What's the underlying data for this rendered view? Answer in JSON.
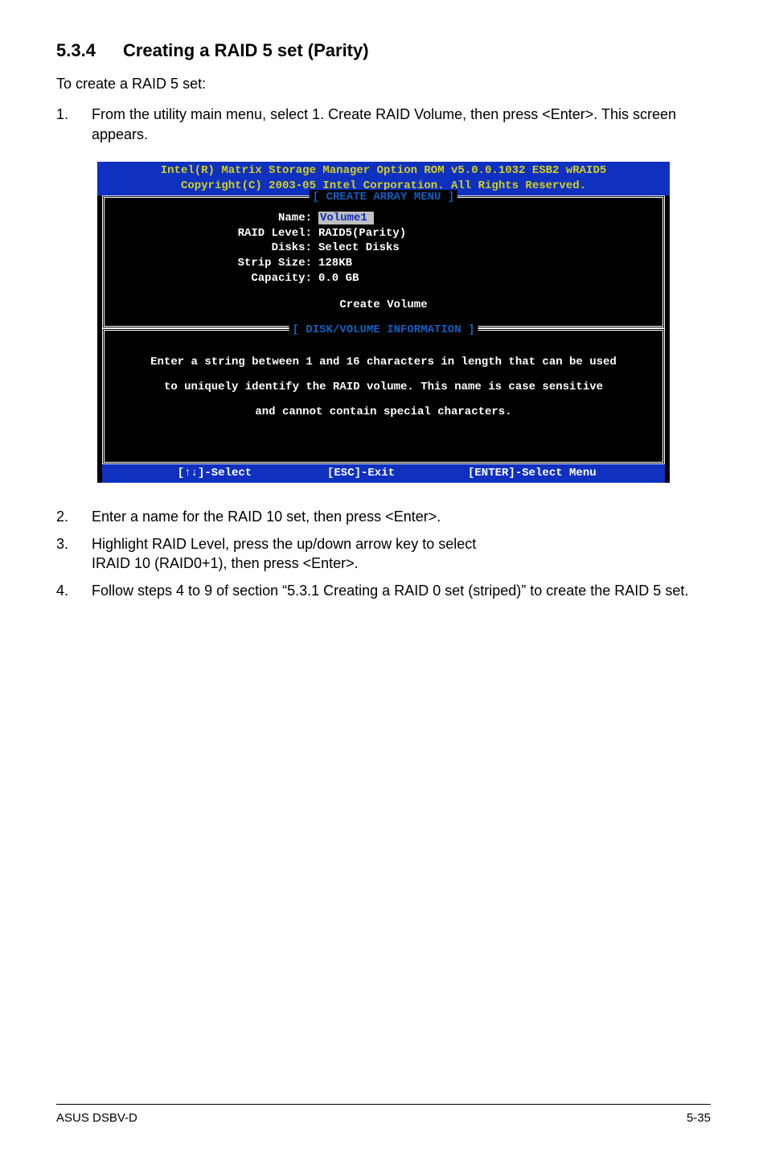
{
  "section": {
    "number": "5.3.4",
    "title": "Creating a RAID 5 set (Parity)"
  },
  "intro": "To create a RAID 5 set:",
  "step1": {
    "num": "1.",
    "text": "From the utility main menu, select 1. Create RAID Volume, then press <Enter>. This screen appears."
  },
  "bios": {
    "header1": "Intel(R) Matrix Storage Manager Option ROM v5.0.0.1032 ESB2 wRAID5",
    "header2": "Copyright(C) 2003-05 Intel Corporation. All Rights Reserved.",
    "frame1_title": "[ CREATE ARRAY MENU ]",
    "rows": {
      "name_k": "Name:",
      "name_v": "Volume1",
      "raid_k": "RAID Level:",
      "raid_v": "RAID5(Parity)",
      "disks_k": "Disks:",
      "disks_v": "Select Disks",
      "strip_k": "Strip Size:",
      "strip_v": "128KB",
      "cap_k": "Capacity:",
      "cap_v": "0.0   GB"
    },
    "create_volume": "Create Volume",
    "frame2_title": "[ DISK/VOLUME INFORMATION ]",
    "info1": "Enter a string between 1 and 16 characters in length that can be used",
    "info2": "to uniquely identify the RAID volume. This name is case sensitive",
    "info3": "and cannot contain special characters.",
    "footer_left": "[↑↓]-Select",
    "footer_mid": "[ESC]-Exit",
    "footer_right": "[ENTER]-Select Menu"
  },
  "step2": {
    "num": "2.",
    "text": "Enter a name for the RAID 10 set, then press <Enter>."
  },
  "step3": {
    "num": "3.",
    "text_a": "Highlight RAID Level, press the up/down arrow key to select",
    "text_b": "IRAID 10 (RAID0+1), then press <Enter>."
  },
  "step4": {
    "num": "4.",
    "text": "Follow steps 4 to 9 of section “5.3.1 Creating a RAID 0 set (striped)” to create the RAID 5 set."
  },
  "footer": {
    "left": "ASUS DSBV-D",
    "right": "5-35"
  }
}
